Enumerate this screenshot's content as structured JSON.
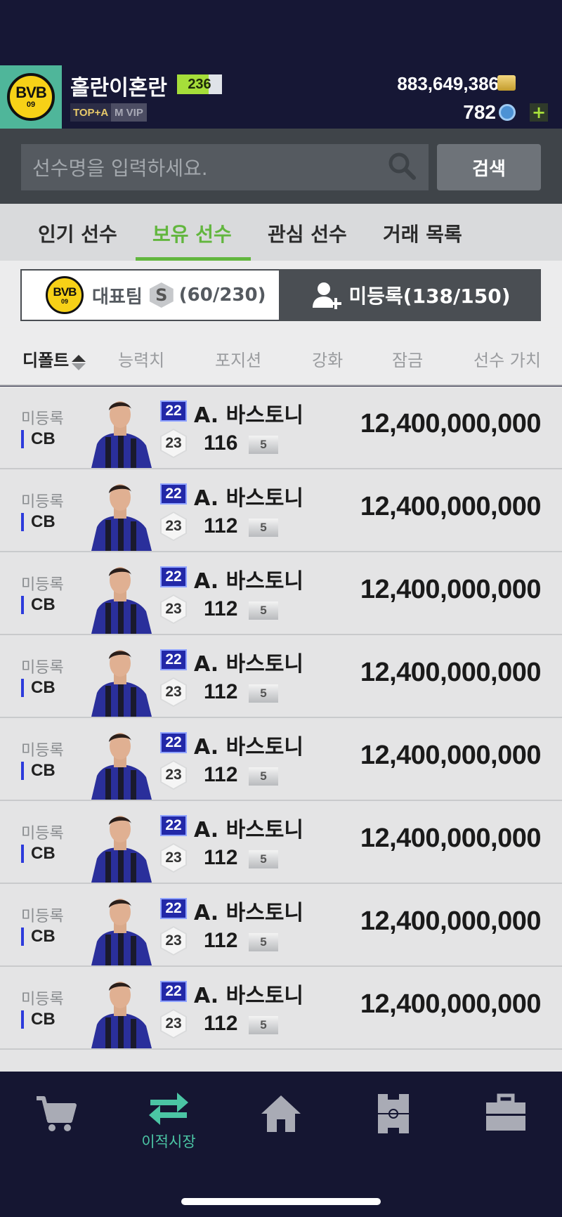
{
  "header": {
    "nickname": "홀란이혼란",
    "level": "236",
    "tag_top": "TOP+A",
    "tag_vip": "M VIP",
    "bp": "883,649,386",
    "fc": "782",
    "plus": "+",
    "club_logo_text": "BVB",
    "club_logo_num": "09"
  },
  "search": {
    "placeholder": "선수명을 입력하세요.",
    "button": "검색"
  },
  "tabs": [
    {
      "label": "인기 선수"
    },
    {
      "label": "보유 선수"
    },
    {
      "label": "관심 선수"
    },
    {
      "label": "거래 목록"
    }
  ],
  "squad": {
    "rep_label": "대표팀",
    "s_icon": "S",
    "rep_count": "(60/230)",
    "unreg_label": "미등록(138/150)"
  },
  "sort": {
    "default": "디폴트",
    "ability": "능력치",
    "position": "포지션",
    "enhance": "강화",
    "lock": "잠금",
    "value": "선수 가치"
  },
  "players": [
    {
      "status": "미등록",
      "pos": "CB",
      "season": "22",
      "name": "A. 바스토니",
      "grade": "23",
      "ovr": "116",
      "enhance": "5",
      "price": "12,400,000,000"
    },
    {
      "status": "미등록",
      "pos": "CB",
      "season": "22",
      "name": "A. 바스토니",
      "grade": "23",
      "ovr": "112",
      "enhance": "5",
      "price": "12,400,000,000"
    },
    {
      "status": "미등록",
      "pos": "CB",
      "season": "22",
      "name": "A. 바스토니",
      "grade": "23",
      "ovr": "112",
      "enhance": "5",
      "price": "12,400,000,000"
    },
    {
      "status": "미등록",
      "pos": "CB",
      "season": "22",
      "name": "A. 바스토니",
      "grade": "23",
      "ovr": "112",
      "enhance": "5",
      "price": "12,400,000,000"
    },
    {
      "status": "미등록",
      "pos": "CB",
      "season": "22",
      "name": "A. 바스토니",
      "grade": "23",
      "ovr": "112",
      "enhance": "5",
      "price": "12,400,000,000"
    },
    {
      "status": "미등록",
      "pos": "CB",
      "season": "22",
      "name": "A. 바스토니",
      "grade": "23",
      "ovr": "112",
      "enhance": "5",
      "price": "12,400,000,000"
    },
    {
      "status": "미등록",
      "pos": "CB",
      "season": "22",
      "name": "A. 바스토니",
      "grade": "23",
      "ovr": "112",
      "enhance": "5",
      "price": "12,400,000,000"
    },
    {
      "status": "미등록",
      "pos": "CB",
      "season": "22",
      "name": "A. 바스토니",
      "grade": "23",
      "ovr": "112",
      "enhance": "5",
      "price": "12,400,000,000"
    }
  ],
  "nav": {
    "active_label": "이적시장",
    "items": [
      "cart-icon",
      "transfer-icon",
      "home-icon",
      "formation-icon",
      "briefcase-icon"
    ]
  },
  "colors": {
    "accent_green": "#62b63e",
    "nav_active": "#4bc5a4",
    "header_bg": "#161735"
  }
}
